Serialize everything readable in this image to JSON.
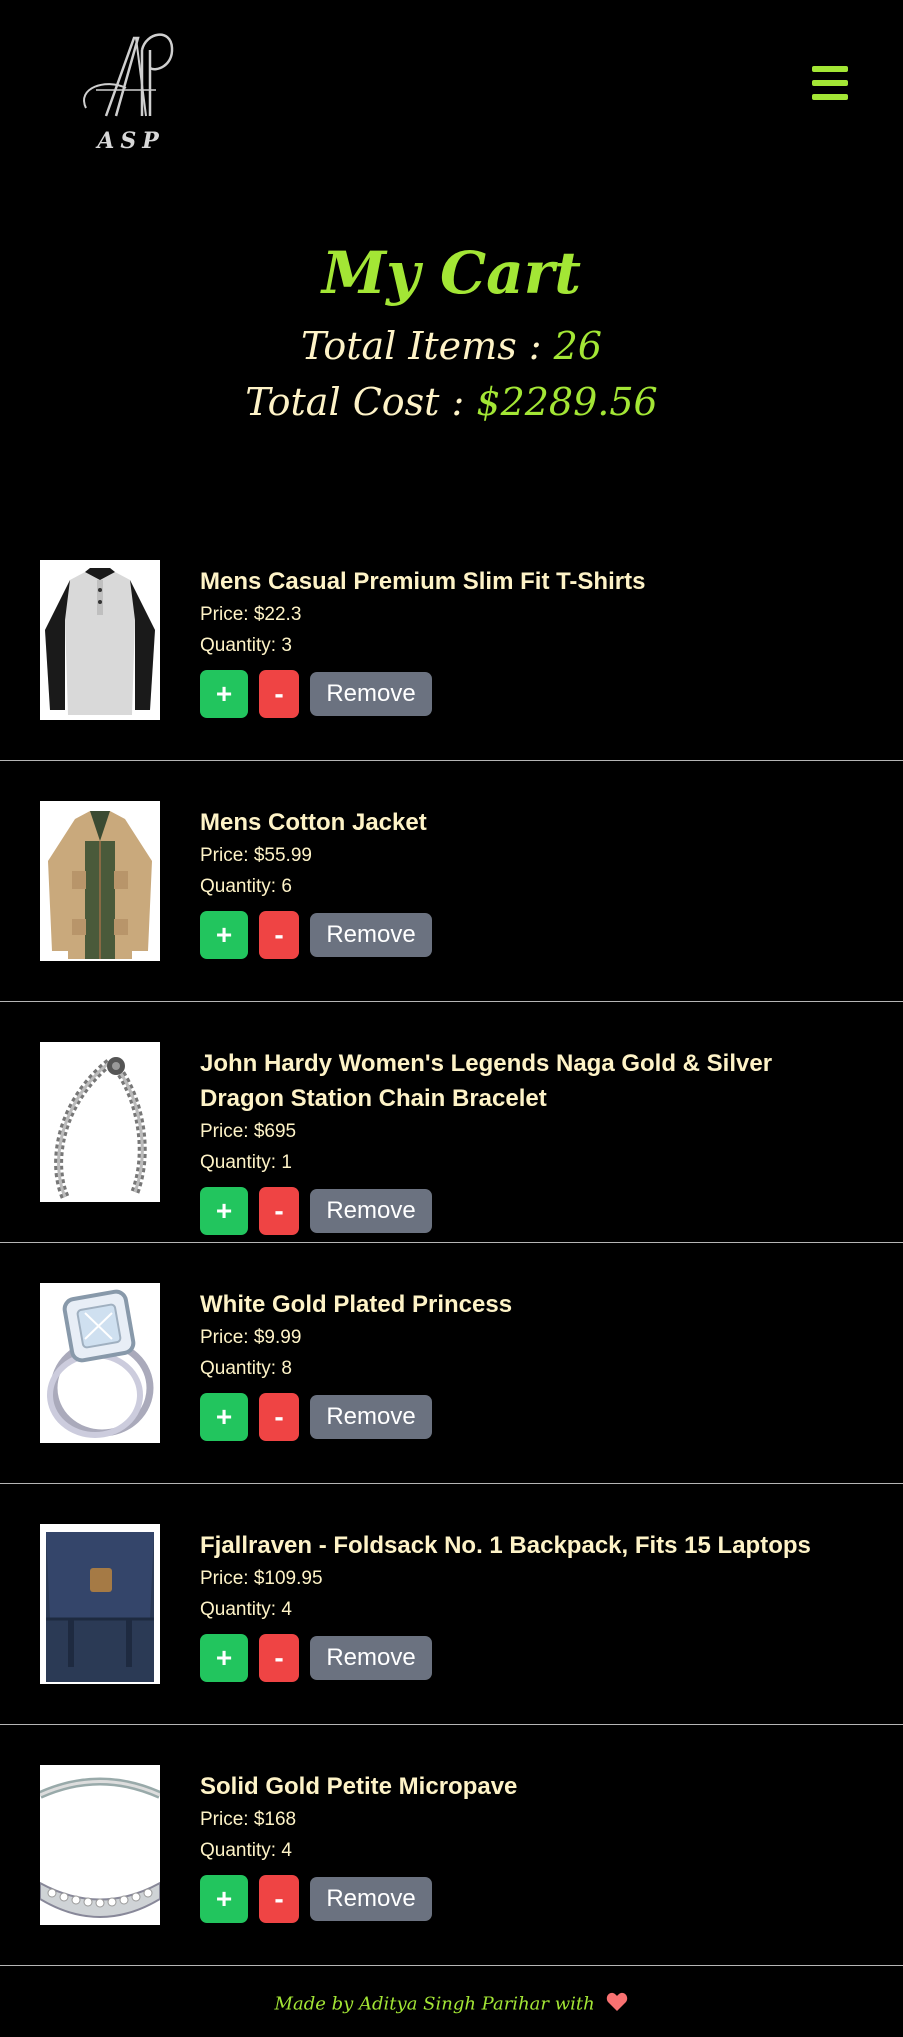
{
  "header": {
    "logo_monogram": "AP",
    "logo_text": "ASP",
    "menu_icon": "hamburger-menu-icon"
  },
  "cart": {
    "title": "My Cart",
    "total_items_label": "Total Items : ",
    "total_items_value": "26",
    "total_cost_label": "Total Cost : ",
    "total_cost_value": "$2289.56"
  },
  "items": [
    {
      "title": "Mens Casual Premium Slim Fit T-Shirts",
      "price": "Price: $22.3",
      "quantity": "Quantity: 3",
      "image": "tshirt-image"
    },
    {
      "title": "Mens Cotton Jacket",
      "price": "Price: $55.99",
      "quantity": "Quantity: 6",
      "image": "jacket-image"
    },
    {
      "title": "John Hardy Women's Legends Naga Gold & Silver Dragon Station Chain Bracelet",
      "price": "Price: $695",
      "quantity": "Quantity: 1",
      "image": "bracelet-image"
    },
    {
      "title": "White Gold Plated Princess",
      "price": "Price: $9.99",
      "quantity": "Quantity: 8",
      "image": "ring-image"
    },
    {
      "title": "Fjallraven - Foldsack No. 1 Backpack, Fits 15 Laptops",
      "price": "Price: $109.95",
      "quantity": "Quantity: 4",
      "image": "backpack-image"
    },
    {
      "title": "Solid Gold Petite Micropave",
      "price": "Price: $168",
      "quantity": "Quantity: 4",
      "image": "band-ring-image"
    }
  ],
  "buttons": {
    "plus": "+",
    "minus": "-",
    "remove": "Remove"
  },
  "footer": {
    "text": "Made by Aditya Singh Parihar with",
    "heart_icon": "heart-icon"
  },
  "colors": {
    "accent": "#a3e635",
    "text": "#fef3c7",
    "plus": "#22c55e",
    "minus": "#ef4444",
    "remove": "#6b7280",
    "heart": "#f87171"
  }
}
